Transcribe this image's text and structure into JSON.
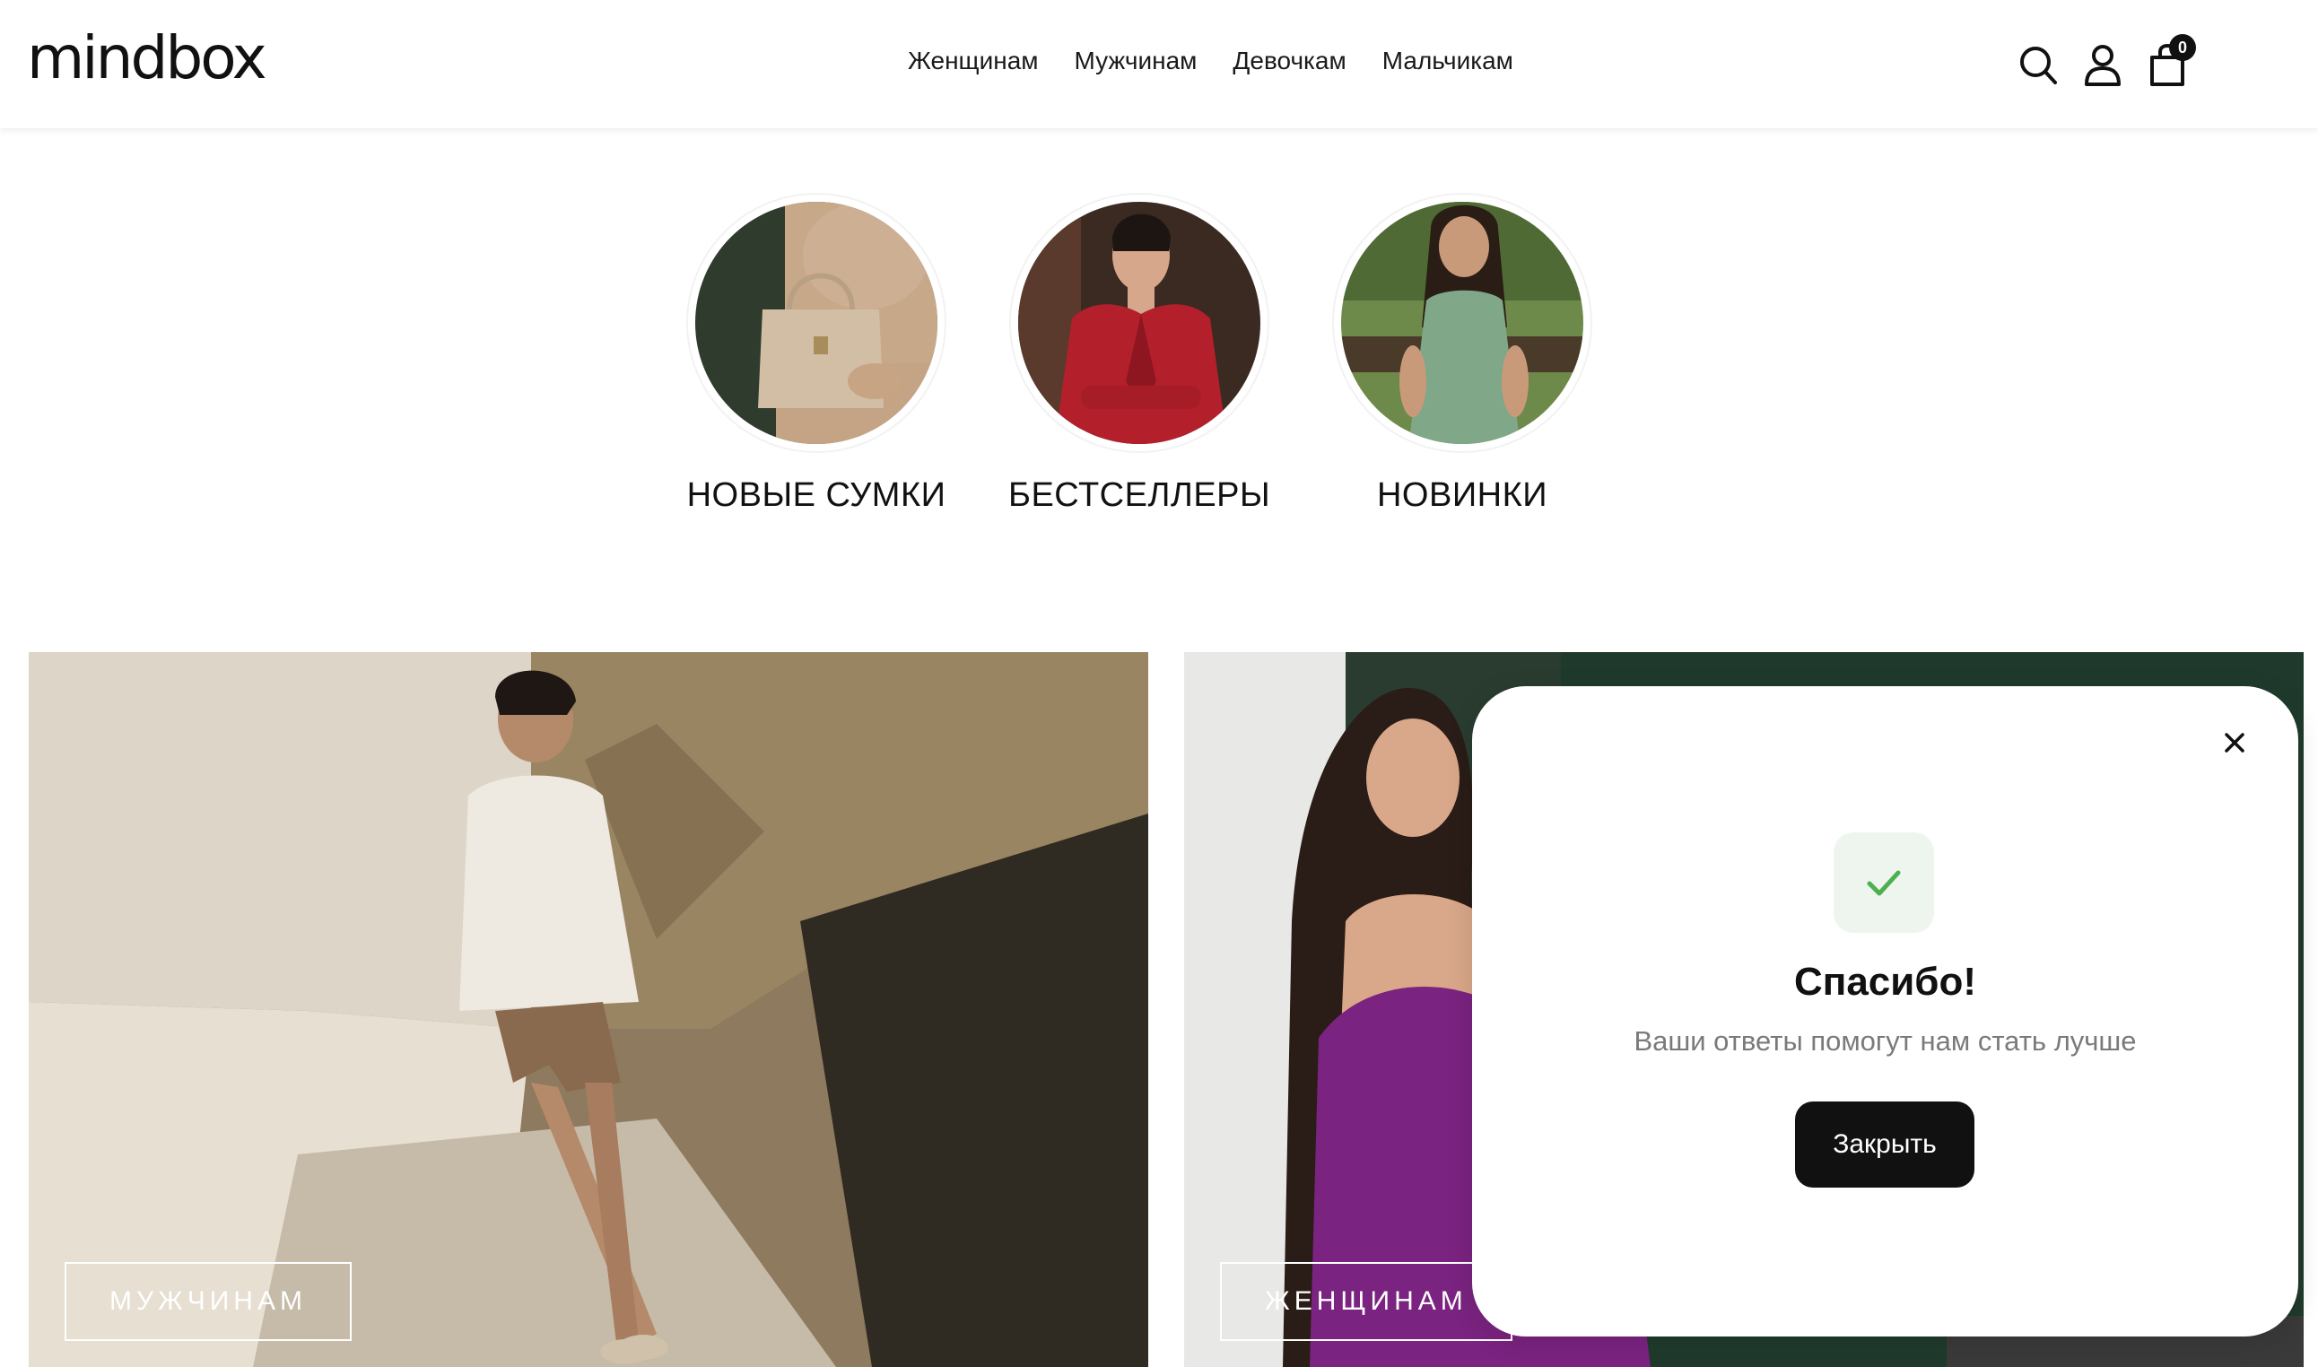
{
  "header": {
    "logo": "mindbox",
    "nav": [
      "Женщинам",
      "Мужчинам",
      "Девочкам",
      "Мальчикам"
    ],
    "icons": [
      "search-icon",
      "user-icon",
      "cart-icon"
    ],
    "cart_count": "0"
  },
  "categories": [
    {
      "label": "НОВЫЕ СУМКИ"
    },
    {
      "label": "БЕСТСЕЛЛЕРЫ"
    },
    {
      "label": "НОВИНКИ"
    }
  ],
  "banners": [
    {
      "button": "МУЖЧИНАМ"
    },
    {
      "button": "ЖЕНЩИНАМ"
    }
  ],
  "modal": {
    "title": "Спасибо!",
    "subtitle": "Ваши ответы помогут нам стать лучше",
    "button": "Закрыть",
    "accent": "#4caf50"
  }
}
